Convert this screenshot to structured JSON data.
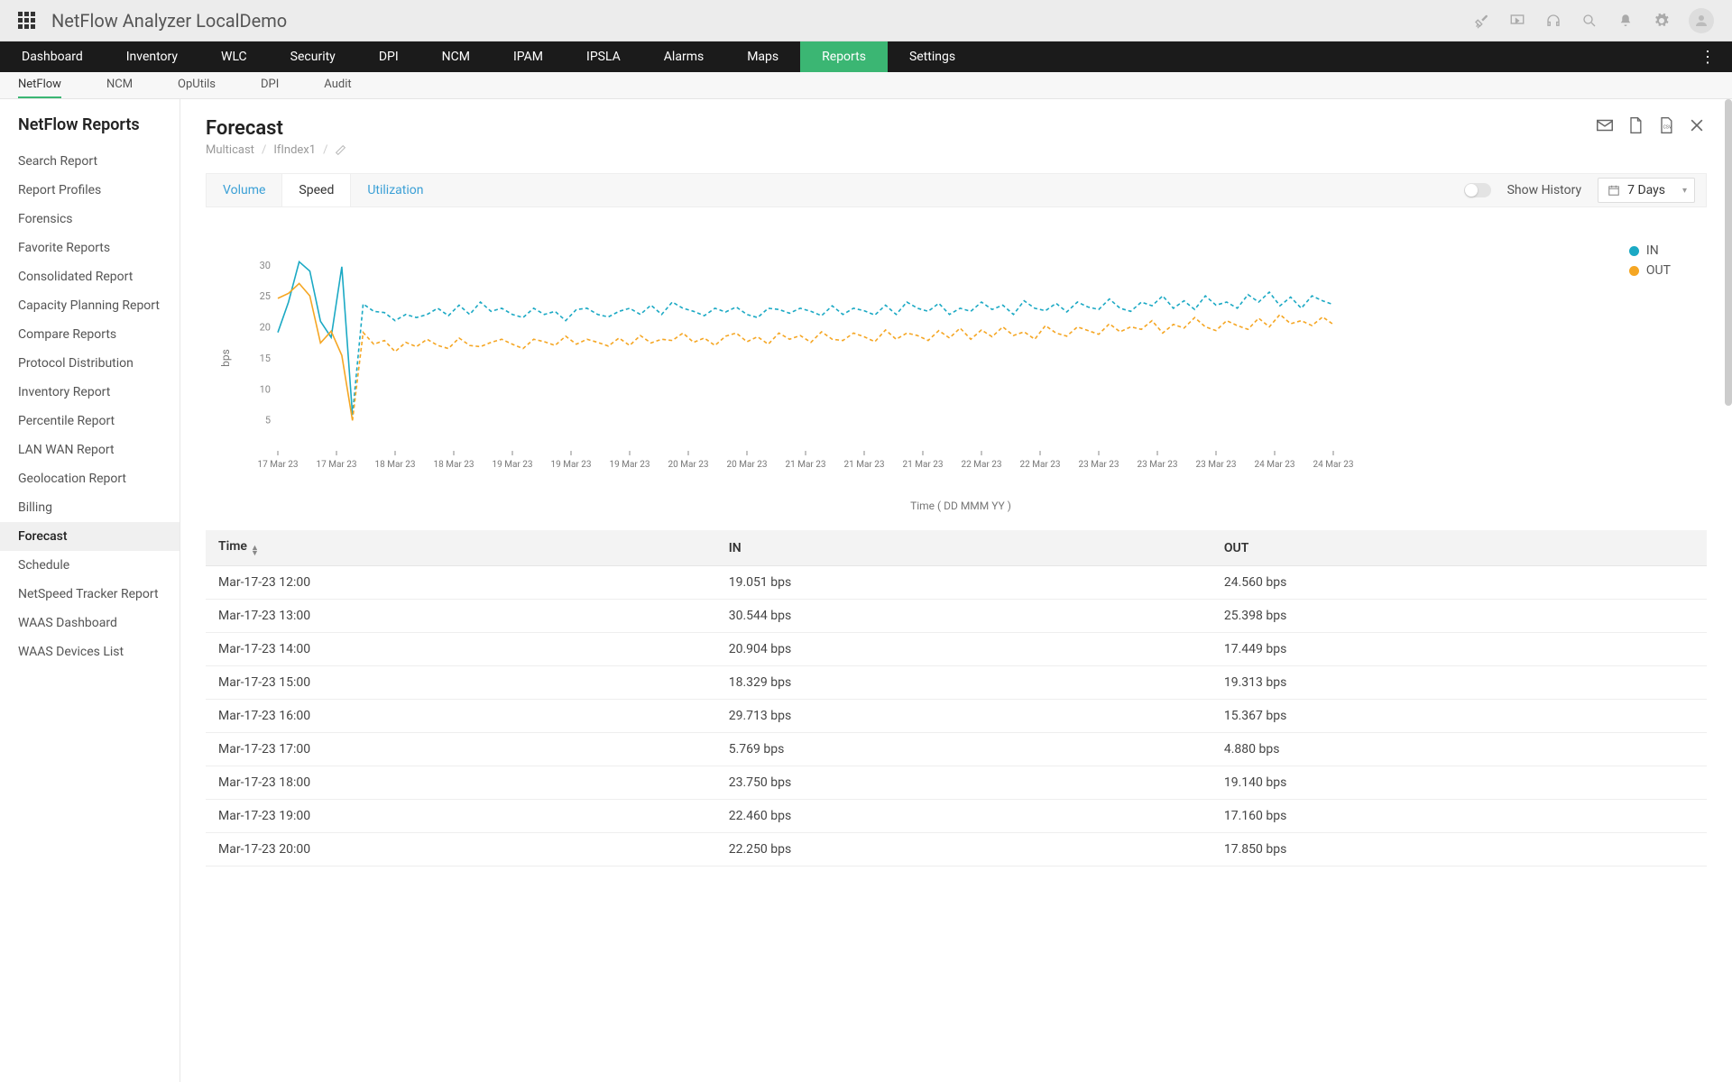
{
  "app_title": "NetFlow Analyzer LocalDemo",
  "main_nav": [
    "Dashboard",
    "Inventory",
    "WLC",
    "Security",
    "DPI",
    "NCM",
    "IPAM",
    "IPSLA",
    "Alarms",
    "Maps",
    "Reports",
    "Settings"
  ],
  "main_nav_active": "Reports",
  "sub_nav": [
    "NetFlow",
    "NCM",
    "OpUtils",
    "DPI",
    "Audit"
  ],
  "sub_nav_active": "NetFlow",
  "sidebar": {
    "title": "NetFlow Reports",
    "items": [
      "Search Report",
      "Report Profiles",
      "Forensics",
      "Favorite Reports",
      "Consolidated Report",
      "Capacity Planning Report",
      "Compare Reports",
      "Protocol Distribution",
      "Inventory Report",
      "Percentile Report",
      "LAN WAN Report",
      "Geolocation Report",
      "Billing",
      "Forecast",
      "Schedule",
      "NetSpeed Tracker Report",
      "WAAS Dashboard",
      "WAAS Devices List"
    ],
    "active": "Forecast"
  },
  "page": {
    "title": "Forecast",
    "breadcrumb": [
      "Multicast",
      "IfIndex1"
    ]
  },
  "filter": {
    "tabs": [
      "Volume",
      "Speed",
      "Utilization"
    ],
    "selected": "Speed",
    "history_label": "Show History",
    "period": "7 Days"
  },
  "colors": {
    "in": "#1ba9c4",
    "out": "#f5a623"
  },
  "chart_data": {
    "type": "line",
    "title": "",
    "xlabel": "Time ( DD MMM YY )",
    "ylabel": "bps",
    "ylim": [
      0,
      32
    ],
    "yticks": [
      5,
      10,
      15,
      20,
      25,
      30
    ],
    "xticks": [
      "17 Mar 23",
      "17 Mar 23",
      "18 Mar 23",
      "18 Mar 23",
      "19 Mar 23",
      "19 Mar 23",
      "19 Mar 23",
      "20 Mar 23",
      "20 Mar 23",
      "21 Mar 23",
      "21 Mar 23",
      "21 Mar 23",
      "22 Mar 23",
      "22 Mar 23",
      "23 Mar 23",
      "23 Mar 23",
      "23 Mar 23",
      "24 Mar 23",
      "24 Mar 23"
    ],
    "series": [
      {
        "name": "IN",
        "values": [
          19.1,
          24,
          30.5,
          29,
          20.9,
          18.3,
          29.7,
          5.8,
          23.7,
          22.5,
          22.3,
          21,
          22,
          21.5,
          22,
          23,
          21.8,
          23.5,
          22,
          24,
          22.5,
          23,
          22,
          21.5,
          23,
          22,
          22.5,
          21,
          22.8,
          23,
          22,
          21.6,
          22.5,
          23,
          22,
          23.5,
          22,
          24,
          23,
          22.5,
          21.8,
          23,
          22.4,
          23.2,
          22,
          21.5,
          23,
          22.8,
          22.2,
          23,
          22.5,
          21.8,
          23.4,
          22,
          23,
          22.6,
          21.9,
          23.5,
          22,
          24,
          23,
          22.5,
          23.8,
          22,
          23,
          22.5,
          24,
          22.8,
          23.5,
          22,
          24.2,
          23,
          22.6,
          23.8,
          22.4,
          24,
          23.2,
          22.8,
          24.5,
          23,
          22.5,
          24,
          23.4,
          25,
          23,
          24.2,
          22.8,
          25,
          23.5,
          24,
          23,
          25.2,
          24,
          25.6,
          23.4,
          24.8,
          23,
          25,
          24.2,
          23.6
        ]
      },
      {
        "name": "OUT",
        "values": [
          24.6,
          25.4,
          27,
          25,
          17.4,
          19.3,
          15.4,
          4.9,
          19.1,
          17.2,
          17.8,
          16,
          17.5,
          16.8,
          18,
          17,
          16.5,
          18.2,
          17,
          16.8,
          17.5,
          18,
          17.2,
          16.5,
          18,
          17.6,
          17,
          18.5,
          17.2,
          18,
          17.5,
          16.9,
          18.2,
          17,
          18.6,
          17.4,
          18,
          17.8,
          19,
          17.5,
          18.2,
          17,
          18.5,
          19,
          17.6,
          18.4,
          17.2,
          19,
          18,
          18.6,
          17.5,
          19.2,
          18,
          17.8,
          19,
          18.4,
          17.6,
          19.5,
          18,
          19,
          18.6,
          17.8,
          19.4,
          18.2,
          19.8,
          18,
          19.5,
          18.4,
          20,
          18.6,
          19.2,
          18,
          20.2,
          19,
          18.5,
          20,
          19.4,
          18.8,
          20.5,
          19.2,
          20,
          19.6,
          21,
          19,
          20.4,
          19.8,
          21.5,
          20,
          19.4,
          21,
          20.2,
          19.6,
          21.4,
          20,
          22,
          20.5,
          21,
          20.2,
          21.6,
          20.4
        ]
      }
    ],
    "legend": [
      "IN",
      "OUT"
    ]
  },
  "table": {
    "columns": [
      "Time",
      "IN",
      "OUT"
    ],
    "rows": [
      {
        "time": "Mar-17-23 12:00",
        "in": "19.051 bps",
        "out": "24.560 bps"
      },
      {
        "time": "Mar-17-23 13:00",
        "in": "30.544 bps",
        "out": "25.398 bps"
      },
      {
        "time": "Mar-17-23 14:00",
        "in": "20.904 bps",
        "out": "17.449 bps"
      },
      {
        "time": "Mar-17-23 15:00",
        "in": "18.329 bps",
        "out": "19.313 bps"
      },
      {
        "time": "Mar-17-23 16:00",
        "in": "29.713 bps",
        "out": "15.367 bps"
      },
      {
        "time": "Mar-17-23 17:00",
        "in": "5.769 bps",
        "out": "4.880 bps"
      },
      {
        "time": "Mar-17-23 18:00",
        "in": "23.750 bps",
        "out": "19.140 bps"
      },
      {
        "time": "Mar-17-23 19:00",
        "in": "22.460 bps",
        "out": "17.160 bps"
      },
      {
        "time": "Mar-17-23 20:00",
        "in": "22.250 bps",
        "out": "17.850 bps"
      }
    ]
  }
}
